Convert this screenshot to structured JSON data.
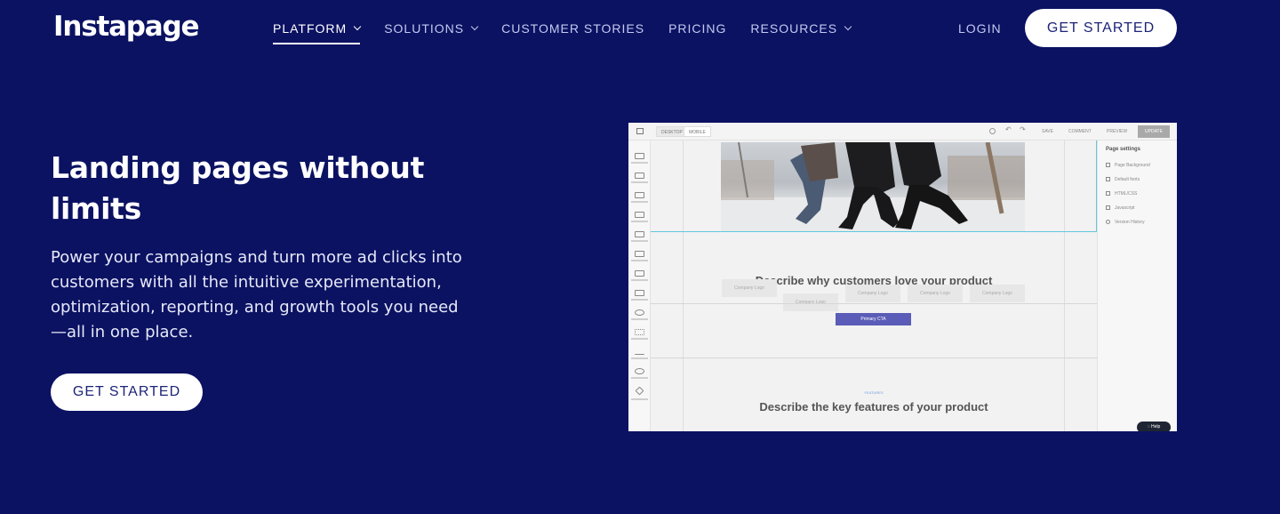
{
  "brand": {
    "logo": "Instapage"
  },
  "nav": {
    "items": [
      {
        "label": "PLATFORM",
        "dropdown": true,
        "active": true
      },
      {
        "label": "SOLUTIONS",
        "dropdown": true
      },
      {
        "label": "CUSTOMER STORIES"
      },
      {
        "label": "PRICING"
      },
      {
        "label": "RESOURCES",
        "dropdown": true
      }
    ],
    "login": "LOGIN",
    "cta": "GET STARTED"
  },
  "hero": {
    "title": "Landing pages without limits",
    "subtitle": "Power your campaigns and turn more ad clicks into customers with all the intuitive experimentation, optimization, reporting, and growth tools you need—all in one place.",
    "cta": "GET STARTED"
  },
  "editor": {
    "toggles": [
      "DESKTOP",
      "MOBILE"
    ],
    "actions": [
      "SAVE",
      "COMMENT",
      "PREVIEW"
    ],
    "publish": "UPDATE",
    "headline_1": "Describe why customers love your product",
    "logos": [
      "Company Logo",
      "Company Logo",
      "Company Logo",
      "Company Logo",
      "Company Logo"
    ],
    "primary_cta": "Primary CTA",
    "features_tag": "FEATURES",
    "headline_2": "Describe the key features of your product",
    "page_settings": {
      "title": "Page settings",
      "items": [
        "Page Background",
        "Default fonts",
        "HTML/CSS",
        "Javascript",
        "Version History"
      ]
    },
    "help": "Help"
  },
  "colors": {
    "background": "#0b1262",
    "button_text": "#1d2478",
    "cta_purple": "#5a5cb7",
    "selection": "#63c7de"
  }
}
